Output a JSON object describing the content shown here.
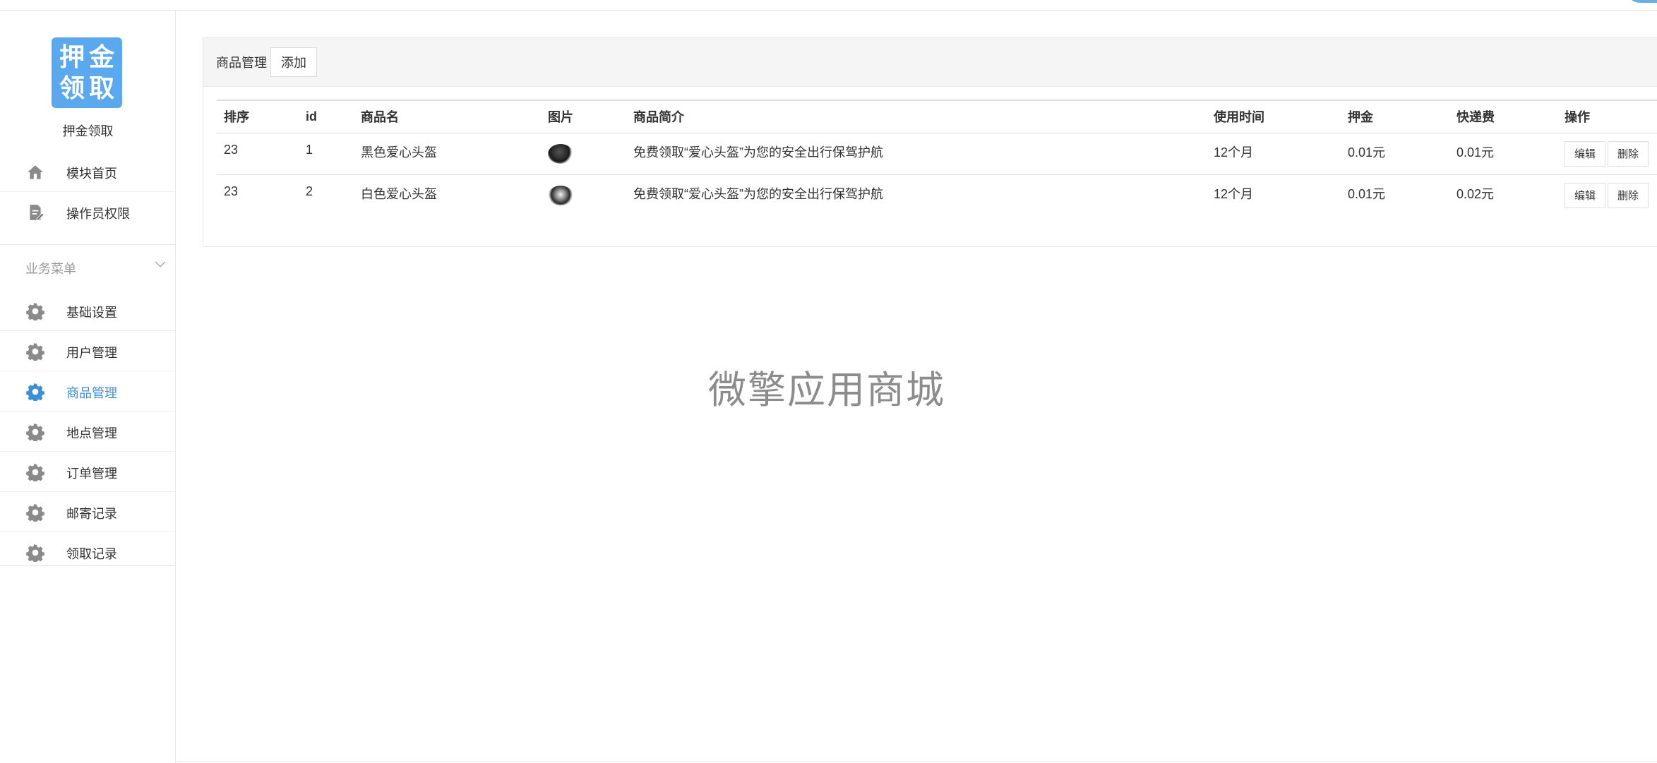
{
  "sidebar": {
    "logo_text": [
      "押",
      "金",
      "领",
      "取"
    ],
    "app_name": "押金领取",
    "top_items": [
      {
        "label": "模块首页",
        "icon": "home-icon"
      },
      {
        "label": "操作员权限",
        "icon": "document-edit-icon"
      }
    ],
    "group_title": "业务菜单",
    "group_items": [
      {
        "label": "基础设置",
        "icon": "gear-icon"
      },
      {
        "label": "用户管理",
        "icon": "gear-icon"
      },
      {
        "label": "商品管理",
        "icon": "gear-icon",
        "active": true
      },
      {
        "label": "地点管理",
        "icon": "gear-icon"
      },
      {
        "label": "订单管理",
        "icon": "gear-icon"
      },
      {
        "label": "邮寄记录",
        "icon": "gear-icon"
      },
      {
        "label": "领取记录",
        "icon": "gear-icon"
      }
    ]
  },
  "panel": {
    "title": "商品管理",
    "add_label": "添加"
  },
  "table": {
    "headers": [
      "排序",
      "id",
      "商品名",
      "图片",
      "商品简介",
      "使用时间",
      "押金",
      "快递费",
      "操作"
    ],
    "rows": [
      {
        "sort": "23",
        "id": "1",
        "name": "黑色爱心头盔",
        "image": "black-helmet-thumbnail",
        "intro": "免费领取“爱心头盔”为您的安全出行保驾护航",
        "duration": "12个月",
        "deposit": "0.01元",
        "shipping": "0.01元"
      },
      {
        "sort": "23",
        "id": "2",
        "name": "白色爱心头盔",
        "image": "white-helmet-thumbnail",
        "intro": "免费领取“爱心头盔”为您的安全出行保驾护航",
        "duration": "12个月",
        "deposit": "0.01元",
        "shipping": "0.02元"
      }
    ],
    "edit_label": "编辑",
    "delete_label": "删除"
  },
  "watermark": "微擎应用商城",
  "colors": {
    "accent": "#3b8fd9",
    "logo_bg": "#5aa9ef",
    "icon_gray": "#8a8a8a"
  }
}
